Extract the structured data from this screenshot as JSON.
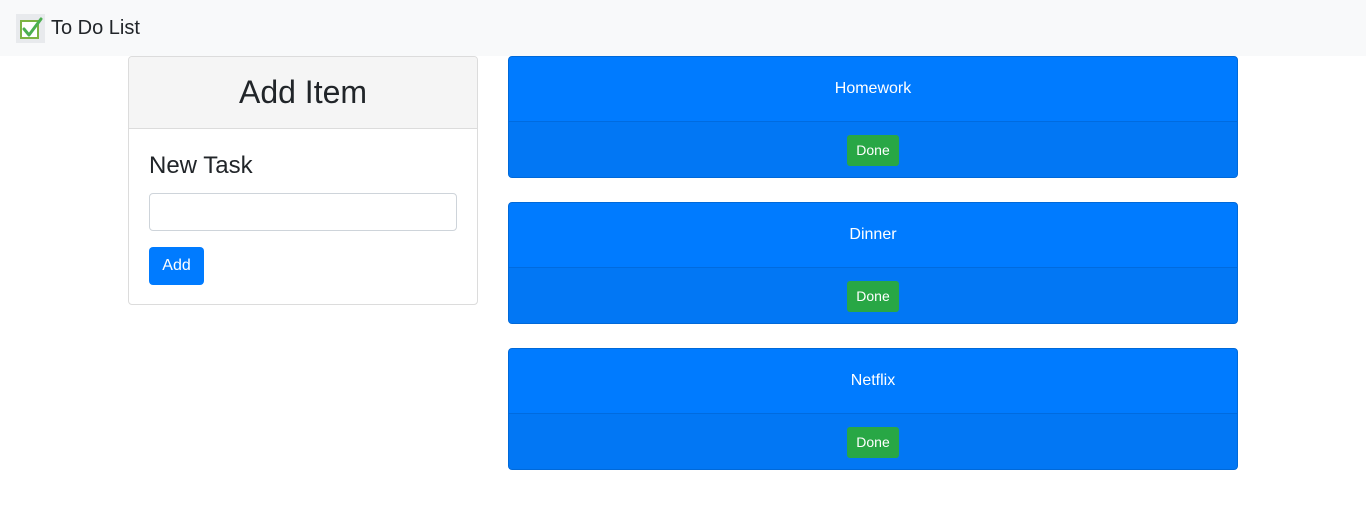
{
  "navbar": {
    "brand_text": "To Do List",
    "brand_icon": "checkbox-checked-icon"
  },
  "add_item": {
    "title": "Add Item",
    "field_label": "New Task",
    "input_value": "",
    "button_label": "Add"
  },
  "tasks": [
    {
      "title": "Homework",
      "action_label": "Done"
    },
    {
      "title": "Dinner",
      "action_label": "Done"
    },
    {
      "title": "Netflix",
      "action_label": "Done"
    }
  ],
  "colors": {
    "primary": "#007bff",
    "success": "#28a745",
    "navbar_bg": "#f8f9fa"
  }
}
